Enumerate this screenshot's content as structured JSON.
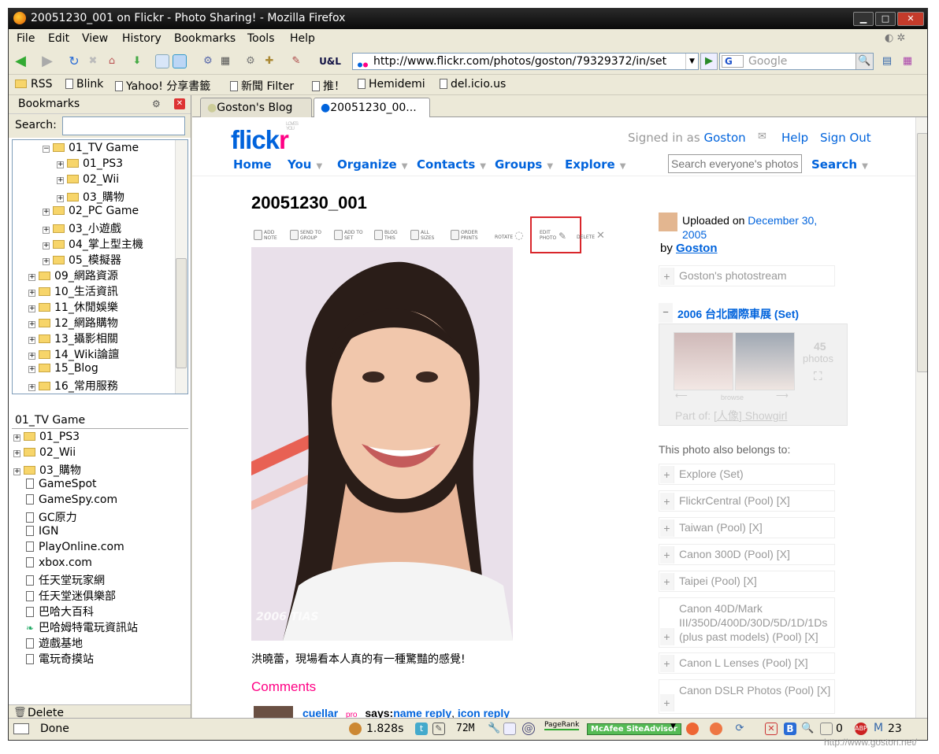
{
  "window": {
    "title": "20051230_001  on  Flickr - Photo Sharing! - Mozilla Firefox"
  },
  "menu": [
    "File",
    "Edit",
    "View",
    "History",
    "Bookmarks",
    "Tools",
    "Help"
  ],
  "address": {
    "url": "http://www.flickr.com/photos/goston/79329372/in/set"
  },
  "search": {
    "engine": "G",
    "placeholder": "Google"
  },
  "bookmarks_bar": [
    "RSS",
    "Blink",
    "Yahoo! 分享書籤",
    "新聞 Filter",
    "推！",
    "Hemidemi",
    "del.icio.us"
  ],
  "sidebar": {
    "title": "Bookmarks",
    "search_label": "Search:",
    "tree": [
      "01_TV Game",
      "01_PS3",
      "02_Wii",
      "03_購物",
      "02_PC Game",
      "03_小遊戲",
      "04_掌上型主機",
      "05_模擬器",
      "09_網路資源",
      "10_生活資訊",
      "11_休閒娛樂",
      "12_網路購物",
      "13_攝影相關",
      "14_Wiki論譠",
      "15_Blog",
      "16_常用服務"
    ],
    "folder_title": "01_TV Game",
    "folder_items": [
      "01_PS3",
      "02_Wii",
      "03_購物",
      "GameSpot",
      "GameSpy.com",
      "GC原力",
      "IGN",
      "PlayOnline.com",
      "xbox.com",
      "任天堂玩家網",
      "任天堂迷俱樂部",
      "巴哈大百科",
      "巴哈姆特電玩資訊站",
      "遊戲基地",
      "電玩奇摸站"
    ],
    "footer": "Delete"
  },
  "tabs": [
    "Goston's Blog",
    "20051230_00..."
  ],
  "flickr": {
    "logo_a": "flick",
    "logo_b": "r",
    "loves_you": "LOVES YOU",
    "signed_in": "Signed in as",
    "user": "Goston",
    "help": "Help",
    "signout": "Sign Out",
    "nav": [
      "Home",
      "You",
      "Organize",
      "Contacts",
      "Groups",
      "Explore"
    ],
    "search_placeholder": "Search everyone's photos",
    "search_btn": "Search",
    "photo_title": "20051230_001",
    "actions": [
      "ADD NOTE",
      "SEND TO GROUP",
      "ADD TO SET",
      "BLOG THIS",
      "ALL SIZES",
      "ORDER PRINTS",
      "ROTATE",
      "EDIT PHOTO",
      "DELETE"
    ],
    "watermark": "2006 TIAS",
    "caption": "洪曉蕾，現場看本人真的有一種驚豔的感覺!",
    "comments_heading": "Comments",
    "comment": {
      "user": "cuellar",
      "badge": "pro",
      "says": "says:",
      "name_reply": "name reply",
      "icon_reply": "icon reply"
    },
    "uploaded_label": "Uploaded on",
    "uploaded_date": "December 30, 2005",
    "by": "by",
    "by_user": "Goston",
    "photostream": "Goston's photostream",
    "set_title": "2006 台北國際車展 (Set)",
    "set_count": "45",
    "set_count_label": "photos",
    "browse": "browse",
    "part_of": "Part of:",
    "part_of_link": "[人像] Showgirl",
    "also_belongs": "This photo also belongs to:",
    "groups": [
      "Explore (Set)",
      "FlickrCentral (Pool) [X]",
      "Taiwan (Pool) [X]",
      "Canon 300D (Pool) [X]",
      "Taipei (Pool) [X]",
      "Canon 40D/Mark III/350D/400D/30D/5D/1D/1Ds (plus past models) (Pool) [X]",
      "Canon L Lenses (Pool) [X]",
      "Canon DSLR Photos (Pool) [X]"
    ]
  },
  "status": {
    "text": "Done",
    "time": "1.828s",
    "mem": "72M",
    "pagerank": "PageRank",
    "mcafee": "McAfee SiteAdvisor",
    "count0": "0",
    "count23": "23",
    "watermark_url": "http://www.goston.net/"
  },
  "colors": {
    "flickr_blue": "#0063dc",
    "flickr_pink": "#ff0084",
    "highlight_box": "#d9262b"
  }
}
